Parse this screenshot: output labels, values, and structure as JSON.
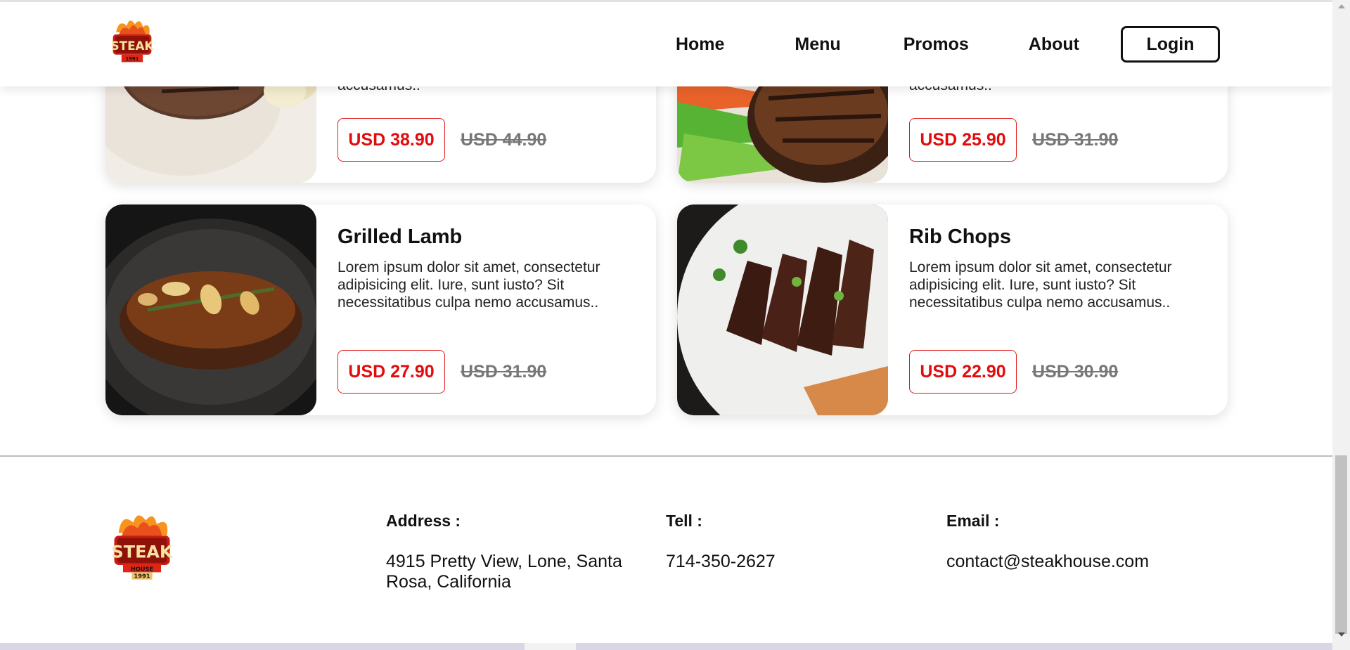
{
  "nav": {
    "logo_alt": "Steak House 1991",
    "links": [
      "Home",
      "Menu",
      "Promos",
      "About"
    ],
    "login_label": "Login"
  },
  "menu": {
    "top_row": [
      {
        "snippet": "accusamus..",
        "price": "USD 38.90",
        "old_price": "USD 44.90"
      },
      {
        "snippet": "accusamus..",
        "price": "USD 25.90",
        "old_price": "USD 31.90"
      }
    ],
    "items": [
      {
        "name": "Grilled Lamb",
        "description": "Lorem ipsum dolor sit amet, consectetur adipisicing elit. Iure, sunt iusto? Sit necessitatibus culpa nemo accusamus..",
        "price": "USD 27.90",
        "old_price": "USD 31.90"
      },
      {
        "name": "Rib Chops",
        "description": "Lorem ipsum dolor sit amet, consectetur adipisicing elit. Iure, sunt iusto? Sit necessitatibus culpa nemo accusamus..",
        "price": "USD 22.90",
        "old_price": "USD 30.90"
      }
    ]
  },
  "footer": {
    "address_label": "Address :",
    "address": "4915 Pretty View, Lone, Santa Rosa, California",
    "tel_label": "Tell :",
    "tel": "714-350-2627",
    "email_label": "Email :",
    "email": "contact@steakhouse.com"
  },
  "logo": {
    "word": "STEAK",
    "sub": "HOUSE",
    "year": "1991"
  },
  "colors": {
    "accent": "#e30b0b",
    "old_price": "#777777",
    "logo_red": "#c81e12",
    "logo_orange": "#f7931e"
  }
}
